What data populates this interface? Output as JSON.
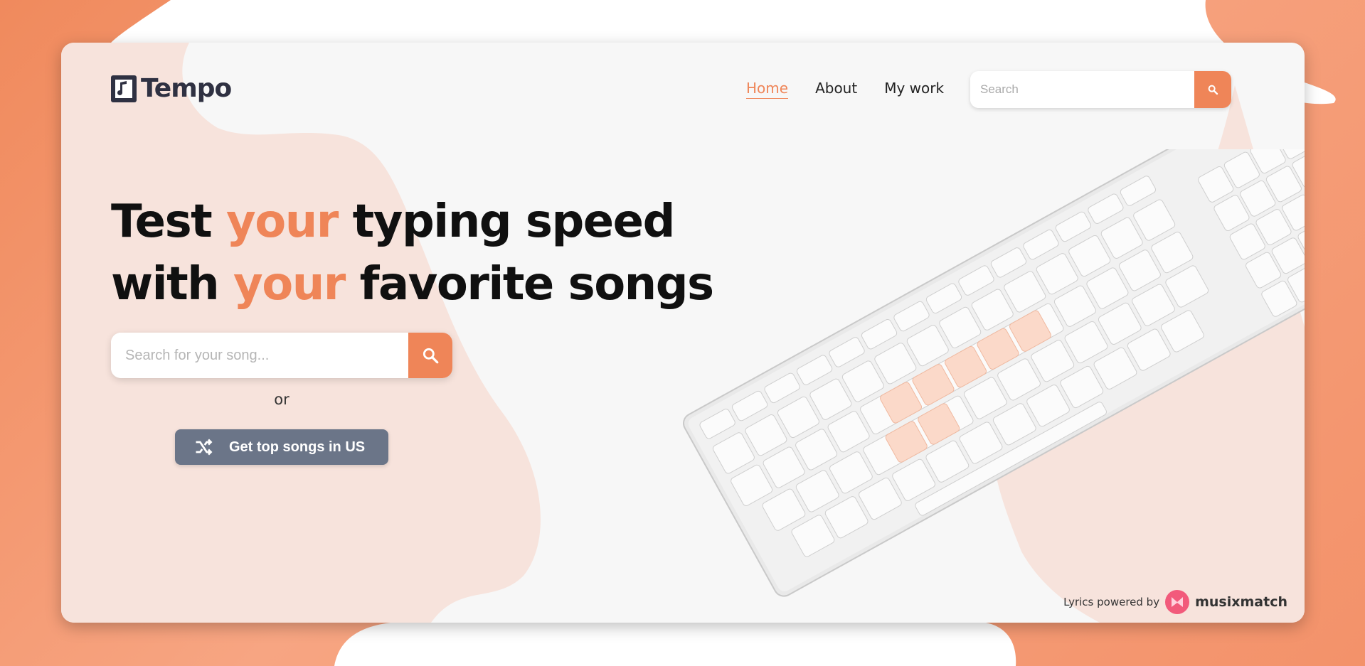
{
  "brand": {
    "name": "Tempo"
  },
  "nav": {
    "items": [
      {
        "label": "Home",
        "active": true
      },
      {
        "label": "About"
      },
      {
        "label": "My work"
      }
    ]
  },
  "top_search": {
    "placeholder": "Search"
  },
  "hero": {
    "line1_a": "Test ",
    "line1_accent": "your",
    "line1_b": " typing speed",
    "line2_a": "with ",
    "line2_accent": "your",
    "line2_b": " favorite songs"
  },
  "song_search": {
    "placeholder": "Search for your song..."
  },
  "or_text": "or",
  "top_songs_button": {
    "label": "Get top songs in US",
    "icon": "shuffle-icon"
  },
  "footer": {
    "powered_by": "Lyrics powered by",
    "partner": "musixmatch"
  },
  "colors": {
    "accent": "#ef8558",
    "dark": "#2f3142",
    "button_gray": "#6b7588"
  }
}
